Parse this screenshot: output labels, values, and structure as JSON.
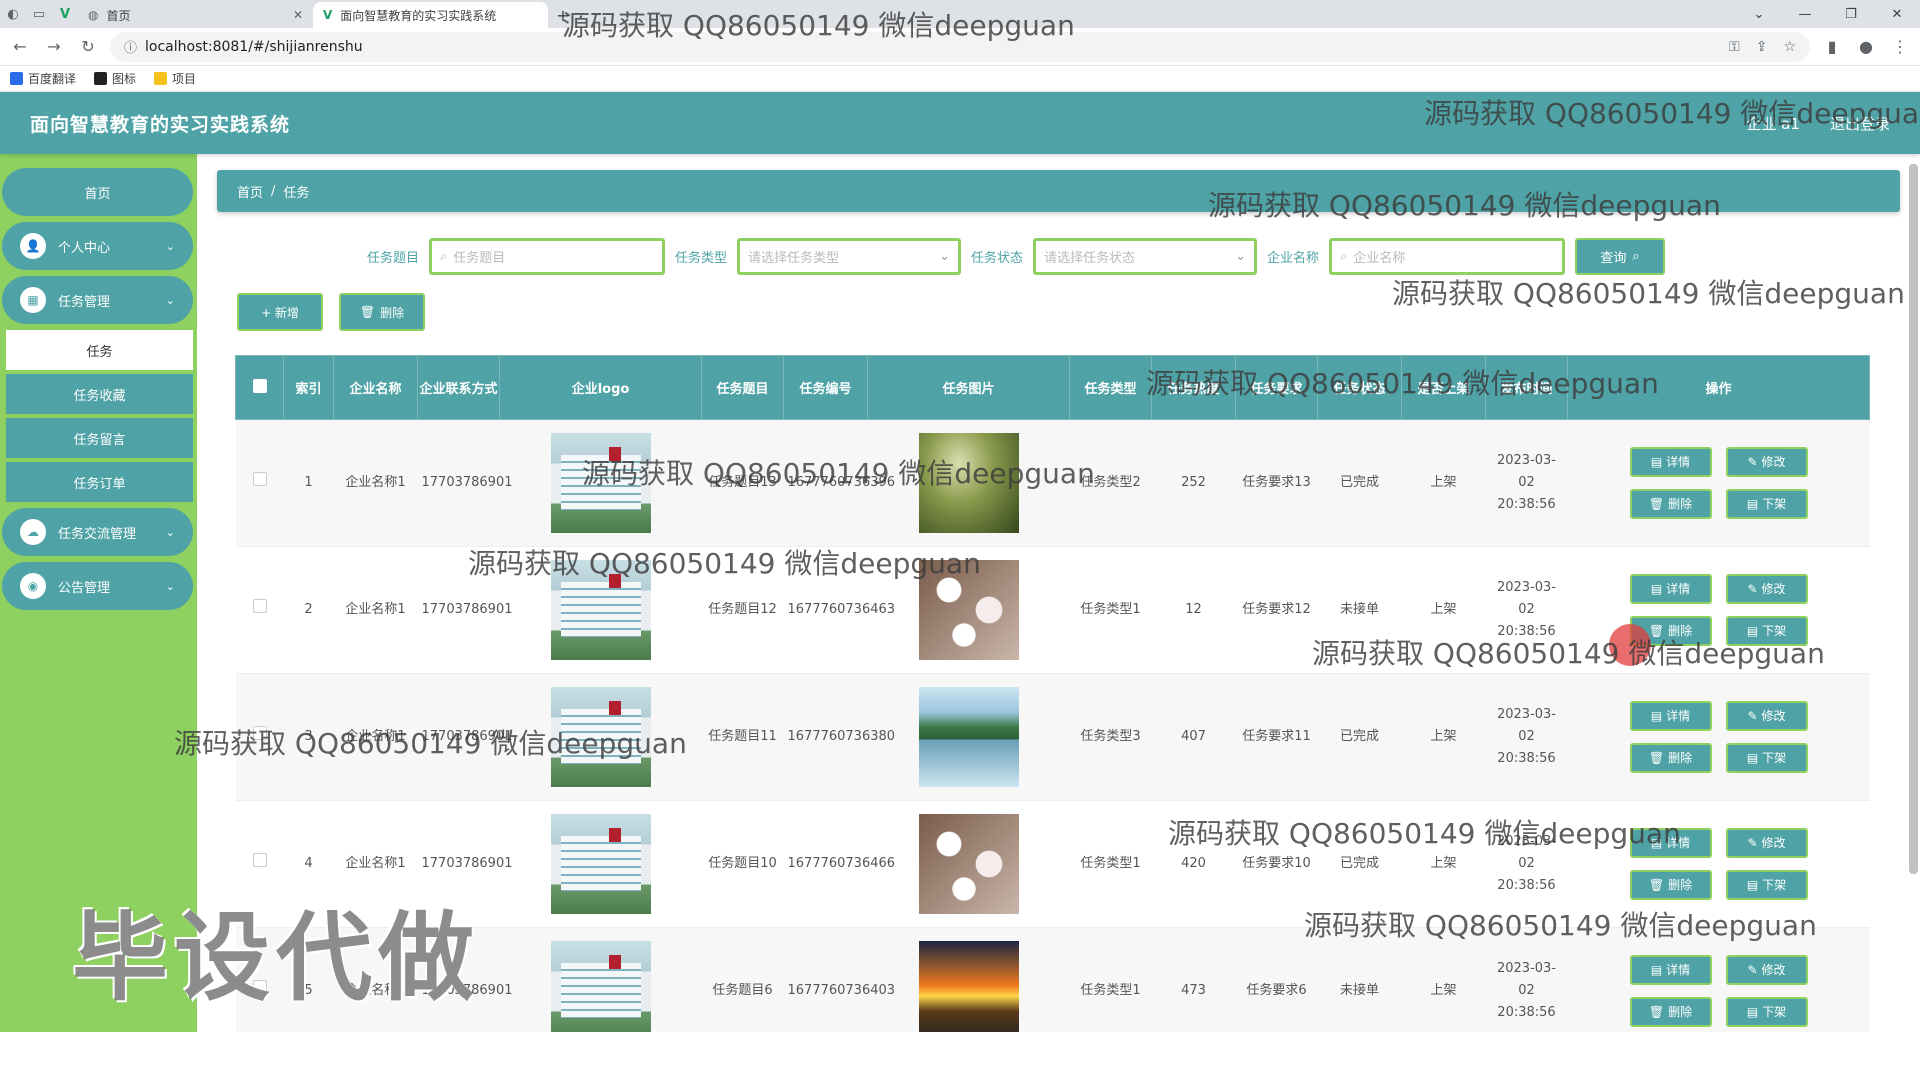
{
  "browser": {
    "tabs": [
      {
        "label": "首页",
        "active": false
      },
      {
        "label": "面向智慧教育的实习实践系统",
        "active": true
      }
    ],
    "url": "localhost:8081/#/shijianrenshu",
    "bookmarks": [
      {
        "label": "百度翻译",
        "color": "#2b6de8"
      },
      {
        "label": "图标",
        "color": "#222222"
      },
      {
        "label": "项目",
        "color": "#f3c11b"
      }
    ]
  },
  "header": {
    "title": "面向智慧教育的实习实践系统",
    "user": "企业 a1",
    "logout": "退出登录"
  },
  "sidebar": {
    "home": "首页",
    "personal": "个人中心",
    "task_mgmt": "任务管理",
    "sub": [
      "任务",
      "任务收藏",
      "任务留言",
      "任务订单"
    ],
    "exchange": "任务交流管理",
    "notice": "公告管理"
  },
  "breadcrumb": {
    "home": "首页",
    "sep": "/",
    "current": "任务"
  },
  "search": {
    "title_label": "任务题目",
    "title_placeholder": "任务题目",
    "type_label": "任务类型",
    "type_placeholder": "请选择任务类型",
    "status_label": "任务状态",
    "status_placeholder": "请选择任务状态",
    "company_label": "企业名称",
    "company_placeholder": "企业名称",
    "query": "查询"
  },
  "actions": {
    "add": "+ 新增",
    "delete": "删除"
  },
  "table": {
    "headers": [
      "索引",
      "企业名称",
      "企业联系方式",
      "企业logo",
      "任务题目",
      "任务编号",
      "任务图片",
      "任务类型",
      "任务热度",
      "任务要求",
      "任务状态",
      "是否上架",
      "发布时间",
      "操作"
    ],
    "rows": [
      {
        "idx": "1",
        "company": "企业名称1",
        "phone": "17703786901",
        "title": "任务题目13",
        "no": "1677760736396",
        "img": "forest",
        "type": "任务类型2",
        "heat": "252",
        "req": "任务要求13",
        "status": "已完成",
        "shelf": "上架",
        "time": "2023-03-02 20:38:56"
      },
      {
        "idx": "2",
        "company": "企业名称1",
        "phone": "17703786901",
        "title": "任务题目12",
        "no": "1677760736463",
        "img": "blossom",
        "type": "任务类型1",
        "heat": "12",
        "req": "任务要求12",
        "status": "未接单",
        "shelf": "上架",
        "time": "2023-03-02 20:38:56"
      },
      {
        "idx": "3",
        "company": "企业名称1",
        "phone": "17703786901",
        "title": "任务题目11",
        "no": "1677760736380",
        "img": "lake",
        "type": "任务类型3",
        "heat": "407",
        "req": "任务要求11",
        "status": "已完成",
        "shelf": "上架",
        "time": "2023-03-02 20:38:56"
      },
      {
        "idx": "4",
        "company": "企业名称1",
        "phone": "17703786901",
        "title": "任务题目10",
        "no": "1677760736466",
        "img": "blossom",
        "type": "任务类型1",
        "heat": "420",
        "req": "任务要求10",
        "status": "已完成",
        "shelf": "上架",
        "time": "2023-03-02 20:38:56"
      },
      {
        "idx": "5",
        "company": "企业名称1",
        "phone": "17703786901",
        "title": "任务题目6",
        "no": "1677760736403",
        "img": "sunset",
        "type": "任务类型1",
        "heat": "473",
        "req": "任务要求6",
        "status": "未接单",
        "shelf": "上架",
        "time": "2023-03-02 20:38:56"
      }
    ],
    "ops": [
      "详情",
      "修改",
      "删除",
      "下架"
    ]
  },
  "watermarks": {
    "qq": "源码获取 QQ86050149 微信deepguan",
    "big": "毕设代做"
  },
  "colors": {
    "primary": "#4fa3a6",
    "accent": "#8ed160"
  }
}
